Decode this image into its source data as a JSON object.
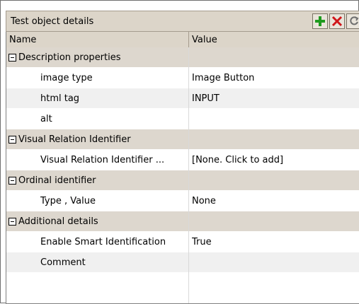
{
  "panel": {
    "title": "Test object details",
    "buttons": [
      {
        "name": "add-button",
        "icon": "plus-icon",
        "color": "#1f9a1f"
      },
      {
        "name": "delete-button",
        "icon": "x-icon",
        "color": "#d0161a"
      },
      {
        "name": "refresh-button",
        "icon": "refresh-icon",
        "color": "#6f6f6f"
      }
    ]
  },
  "grid": {
    "columns": [
      "Name",
      "Value"
    ],
    "rows": [
      {
        "type": "group",
        "name": "Description properties",
        "value": ""
      },
      {
        "type": "prop",
        "name": "image type",
        "value": "Image Button"
      },
      {
        "type": "prop",
        "name": "html tag",
        "value": "INPUT"
      },
      {
        "type": "prop",
        "name": "alt",
        "value": ""
      },
      {
        "type": "group",
        "name": "Visual Relation Identifier",
        "value": ""
      },
      {
        "type": "prop",
        "name": "Visual Relation Identifier ...",
        "value": "[None. Click to add]"
      },
      {
        "type": "group",
        "name": "Ordinal identifier",
        "value": ""
      },
      {
        "type": "prop",
        "name": "Type , Value",
        "value": "None"
      },
      {
        "type": "group",
        "name": "Additional details",
        "value": ""
      },
      {
        "type": "prop",
        "name": "Enable Smart Identification",
        "value": "True"
      },
      {
        "type": "prop",
        "name": "Comment",
        "value": ""
      }
    ]
  }
}
